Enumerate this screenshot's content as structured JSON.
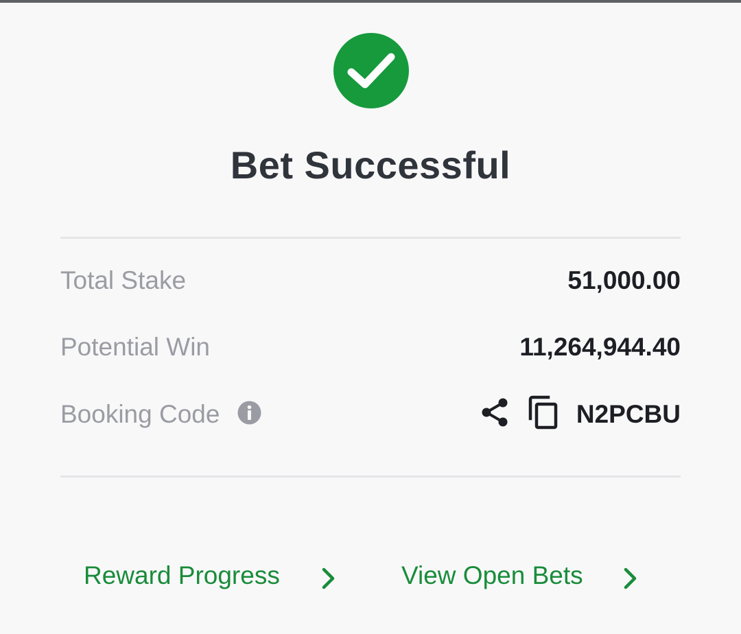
{
  "header": {
    "title": "Bet Successful",
    "status_icon": "check-circle-icon",
    "accent_color": "#169a3c"
  },
  "summary": {
    "total_stake_label": "Total Stake",
    "total_stake_value": "51,000.00",
    "potential_win_label": "Potential Win",
    "potential_win_value": "11,264,944.40",
    "booking_code_label": "Booking Code",
    "booking_code_value": "N2PCBU",
    "booking_icons": [
      "info-icon",
      "share-icon",
      "copy-icon"
    ]
  },
  "links": {
    "reward_progress": "Reward Progress",
    "view_open_bets": "View Open Bets",
    "link_color": "#198c3a"
  }
}
